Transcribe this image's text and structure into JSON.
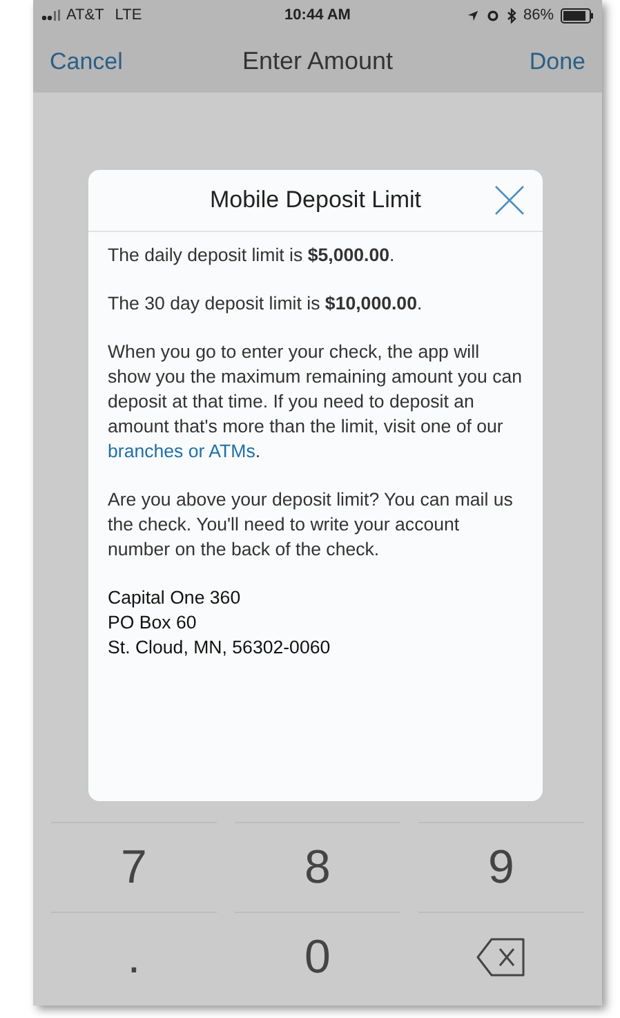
{
  "status_bar": {
    "carrier": "AT&T",
    "network": "LTE",
    "time": "10:44 AM",
    "battery": "86%"
  },
  "nav_bar": {
    "left": "Cancel",
    "title": "Enter Amount",
    "right": "Done"
  },
  "dialog": {
    "title": "Mobile Deposit Limit",
    "paragraphs": [
      {
        "text": "The daily deposit limit is **$5,000.00**."
      },
      {
        "text": "The 30 day deposit limit is **$10,000.00**."
      },
      {
        "text": "When you go to enter your check, the app will show you the maximum remaining amount you can deposit at that time. If you need to deposit an amount that's more than the limit, visit one of our",
        "link": "branches or ATMs",
        "after": "."
      },
      {
        "text": "Are you above your deposit limit? You can mail us the check. You'll need to write your account number on the back of the check."
      }
    ],
    "address": [
      "Capital One 360",
      "PO Box 60",
      "St. Cloud, MN, 56302-0060"
    ]
  },
  "keypad": [
    {
      "kind": "digit",
      "label": "7"
    },
    {
      "kind": "digit",
      "label": "8"
    },
    {
      "kind": "digit",
      "label": "9"
    },
    {
      "kind": "digit",
      "label": "."
    },
    {
      "kind": "digit",
      "label": "0"
    },
    {
      "kind": "delete"
    }
  ]
}
